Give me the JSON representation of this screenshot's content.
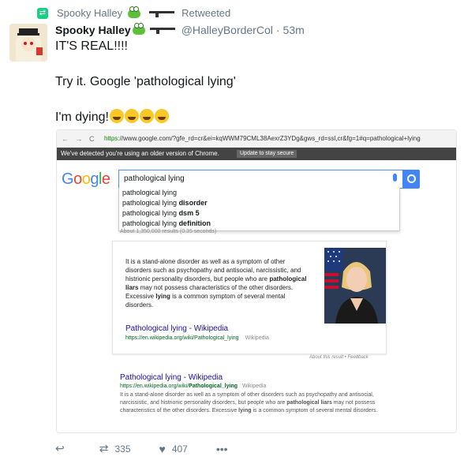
{
  "retweet_banner": {
    "icon": "retweet-icon",
    "user": "Spooky Halley",
    "suffix": "Retweeted"
  },
  "tweet": {
    "display_name": "Spooky Halley",
    "handle": "@HalleyBorderCol",
    "age": "53m",
    "lines": [
      "IT'S REAL!!!!",
      "Try it. Google 'pathological lying'",
      "I'm dying!"
    ]
  },
  "browser": {
    "url_https": "https",
    "url_rest": "://www.google.com/?gfe_rd=cr&ei=kqWWM79CML38AexrZ3YDg&gws_rd=ssl,cr&fg=1#q=pathological+lying",
    "warning": "We've detected you're using an older version of Chrome.",
    "warning_button": "Update to stay secure"
  },
  "google": {
    "logo": "Google",
    "query": "pathological lying",
    "suggestions": [
      {
        "base": "pathological lying",
        "bold": ""
      },
      {
        "base": "pathological lying",
        "bold": "disorder"
      },
      {
        "base": "pathological lying",
        "bold": "dsm 5"
      },
      {
        "base": "pathological lying",
        "bold": "definition"
      }
    ],
    "results_count": "About 1,350,000 results (0.35 seconds)",
    "card": {
      "text_pre": "It is a stand-alone disorder as well as a symptom of other disorders such as psychopathy and antisocial, narcissistic, and histrionic personality disorders, but people who are ",
      "text_bold": "pathological liars",
      "text_mid": " may not possess characteristics of the other disorders. Excessive ",
      "text_bold2": "lying",
      "text_post": " is a common symptom of several mental disorders.",
      "link": "Pathological lying - Wikipedia",
      "url": "https://en.wikipedia.org/wiki/Pathological_lying",
      "source": "Wikipedia"
    },
    "feedback": "About this result • Feedback",
    "result2": {
      "title": "Pathological lying - Wikipedia",
      "url_pre": "https://en.wikipedia.org/wiki/",
      "url_bold": "Pathological_lying",
      "source": "Wikipedia",
      "snippet_pre": "It is a stand-alone disorder as well as a symptom of other disorders such as psychopathy and antisocial, narcissistic, and histrionic personality disorders, but people who are ",
      "snippet_bold": "pathological liars",
      "snippet_mid": " may not possess characteristics of the other disorders. Excessive ",
      "snippet_bold2": "lying",
      "snippet_post": " is a common symptom of several mental disorders."
    }
  },
  "actions": {
    "retweets": "335",
    "likes": "407"
  }
}
